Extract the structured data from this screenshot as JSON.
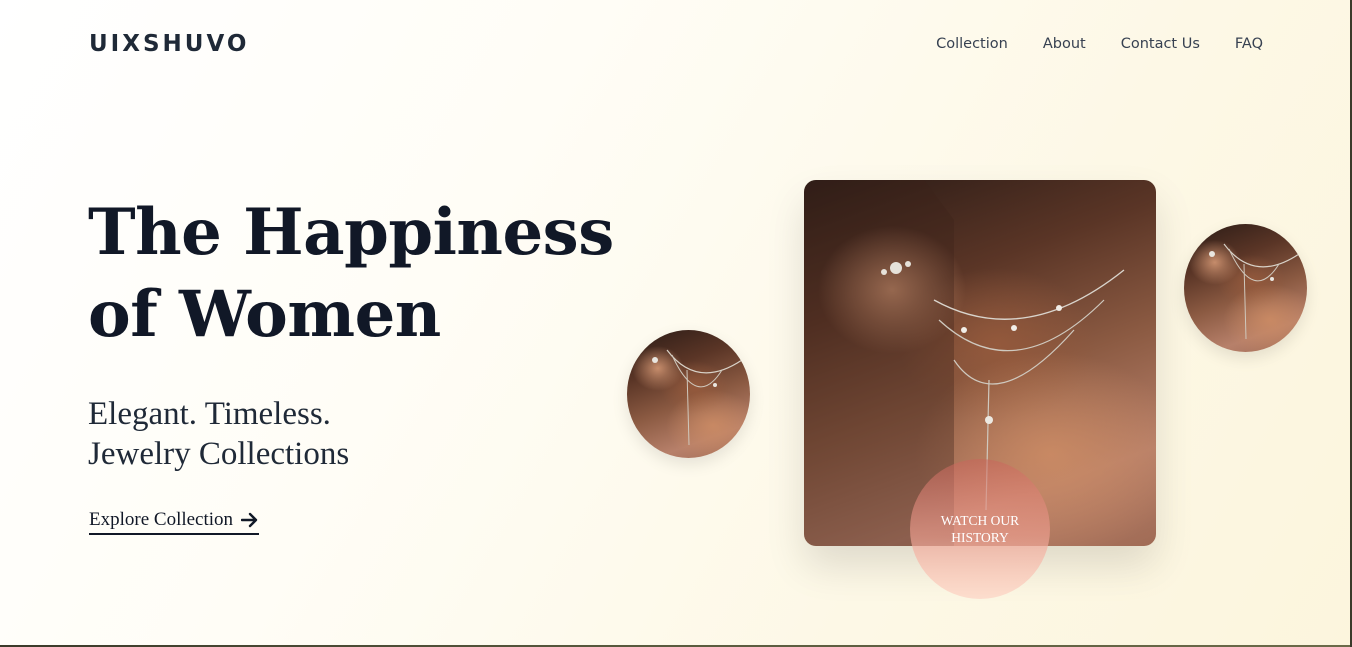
{
  "brand": {
    "logo": "UIXSHUVO"
  },
  "nav": {
    "items": [
      {
        "label": "Collection"
      },
      {
        "label": "About"
      },
      {
        "label": "Contact Us"
      },
      {
        "label": "FAQ"
      }
    ]
  },
  "hero": {
    "title_line1": "The Happiness",
    "title_line2": "of Women",
    "subtitle_line1": "Elegant. Timeless.",
    "subtitle_line2": "Jewelry Collections",
    "cta_label": "Explore Collection",
    "cta_icon": "arrow-right-icon"
  },
  "media": {
    "main_image": "woman-necklace-ring-photo",
    "thumb_left": "woman-necklace-photo-thumb",
    "thumb_right": "woman-necklace-photo-thumb",
    "watch_label": "WATCH OUR HISTORY"
  },
  "colors": {
    "text_dark": "#111827",
    "nav_text": "#374151",
    "background_warm": "#fcf5dd",
    "watch_button": "#f0a091"
  }
}
